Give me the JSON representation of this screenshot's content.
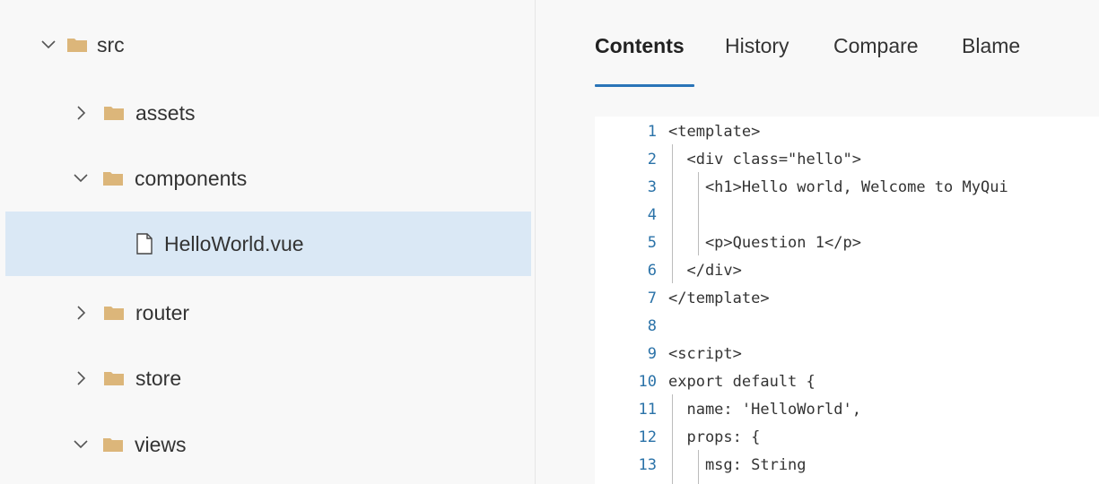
{
  "tree": {
    "items": [
      {
        "label": "src",
        "type": "folder",
        "expanded": true
      },
      {
        "label": "assets",
        "type": "folder",
        "expanded": false
      },
      {
        "label": "components",
        "type": "folder",
        "expanded": true
      },
      {
        "label": "HelloWorld.vue",
        "type": "file",
        "selected": true
      },
      {
        "label": "router",
        "type": "folder",
        "expanded": false
      },
      {
        "label": "store",
        "type": "folder",
        "expanded": false
      },
      {
        "label": "views",
        "type": "folder",
        "expanded": true
      }
    ],
    "selected_color": "#dae8f5",
    "folder_color": "#dcb67a"
  },
  "tabs": [
    {
      "label": "Contents",
      "active": true
    },
    {
      "label": "History",
      "active": false
    },
    {
      "label": "Compare",
      "active": false
    },
    {
      "label": "Blame",
      "active": false
    }
  ],
  "accent_color": "#2a74b8",
  "code": {
    "lines": [
      {
        "num": "1",
        "text": "<template>"
      },
      {
        "num": "2",
        "text": "  <div class=\"hello\">"
      },
      {
        "num": "3",
        "text": "    <h1>Hello world, Welcome to MyQui"
      },
      {
        "num": "4",
        "text": ""
      },
      {
        "num": "5",
        "text": "    <p>Question 1</p>"
      },
      {
        "num": "6",
        "text": "  </div>"
      },
      {
        "num": "7",
        "text": "</template>"
      },
      {
        "num": "8",
        "text": ""
      },
      {
        "num": "9",
        "text": "<script>"
      },
      {
        "num": "10",
        "text": "export default {"
      },
      {
        "num": "11",
        "text": "  name: 'HelloWorld',"
      },
      {
        "num": "12",
        "text": "  props: {"
      },
      {
        "num": "13",
        "text": "    msg: String"
      }
    ]
  }
}
